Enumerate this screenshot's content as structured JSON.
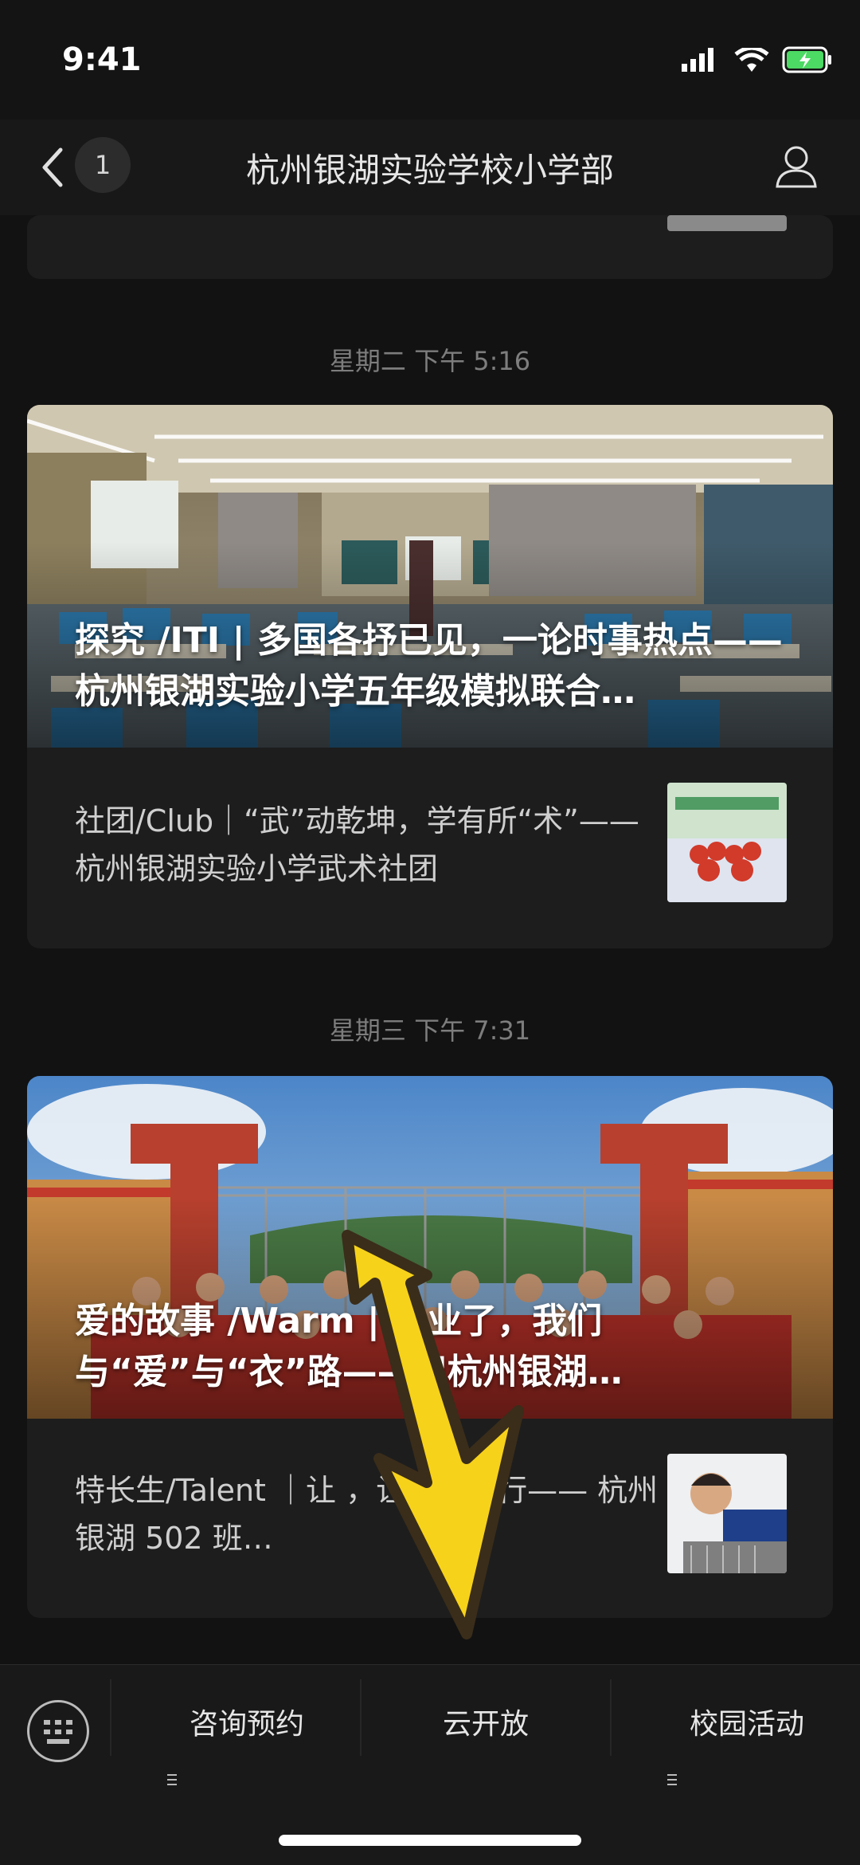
{
  "status": {
    "time": "9:41"
  },
  "nav": {
    "unread_count": "1",
    "title": "杭州银湖实验学校小学部"
  },
  "posts": [
    {
      "date": "星期二 下午 5:16",
      "hero_title": "探究 /ITI | 多国各抒已见，一论时事热点——杭州银湖实验小学五年级模拟联合…",
      "sub_title": "社团/Club｜“武”动乾坤，学有所“术”——杭州银湖实验小学武术社团"
    },
    {
      "date": "星期三 下午 7:31",
      "hero_title": "爱的故事 /Warm | 毕业了，我们与“爱”与“衣”路——记杭州银湖…",
      "sub_title": "特长生/Talent ｜让 ，让创造先行—— 杭州银湖 502 班…"
    }
  ],
  "tabbar": {
    "items": [
      "咨询预约",
      "云开放",
      "校园活动"
    ]
  },
  "colors": {
    "accent_arrow": "#F7D21A",
    "background": "#121212"
  }
}
